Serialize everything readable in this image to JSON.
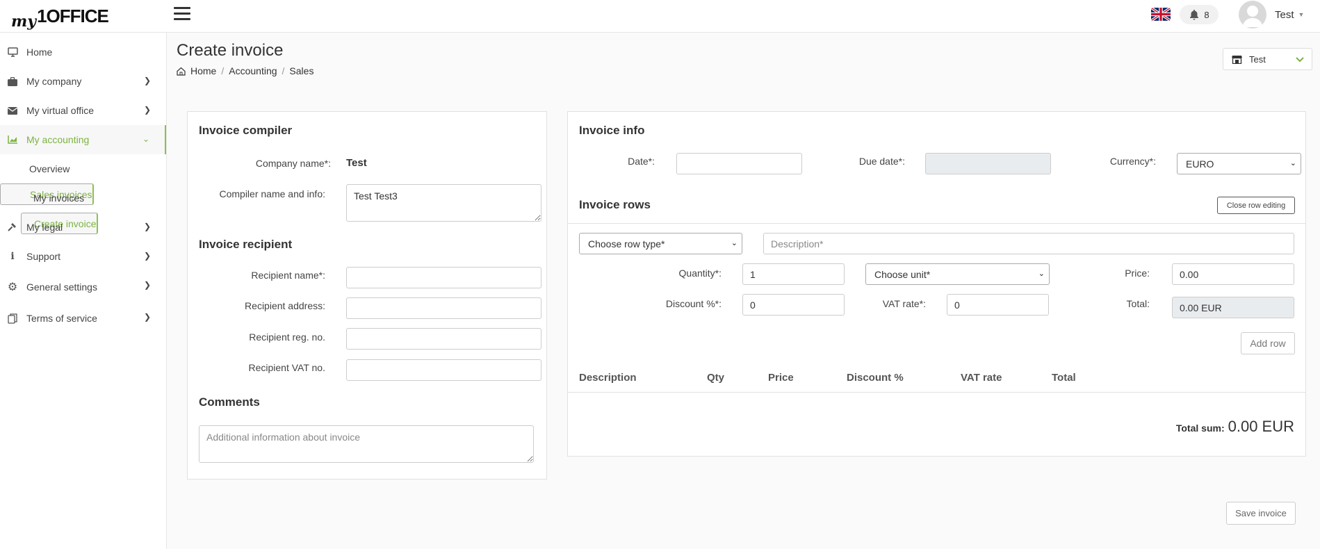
{
  "header": {
    "logo_prefix": "my",
    "logo_main": "1OFFICE",
    "notifications_count": "8",
    "user_name": "Test",
    "language_flag": "uk-flag-icon"
  },
  "sidebar": {
    "items": [
      {
        "label": "Home",
        "icon": "monitor-icon"
      },
      {
        "label": "My company",
        "icon": "briefcase-icon"
      },
      {
        "label": "My virtual office",
        "icon": "envelope-icon"
      },
      {
        "label": "My accounting",
        "icon": "chart-icon"
      },
      {
        "label": "My legal",
        "icon": "gavel-icon"
      },
      {
        "label": "Support",
        "icon": "info-icon"
      },
      {
        "label": "General settings",
        "icon": "gear-icon"
      },
      {
        "label": "Terms of service",
        "icon": "documents-icon"
      }
    ],
    "accounting_sub": {
      "overview": "Overview",
      "sales_invoices": "Sales invoices",
      "my_invoices": "My invoices",
      "create_invoice": "Create invoice"
    },
    "accent_color": "#7cb342"
  },
  "page": {
    "title": "Create invoice",
    "breadcrumb": [
      "Home",
      "Accounting",
      "Sales"
    ],
    "company_selector": "Test"
  },
  "compiler": {
    "heading": "Invoice compiler",
    "company_label": "Company name*:",
    "company_value": "Test",
    "compiler_label": "Compiler name and info:",
    "compiler_value": "Test Test3"
  },
  "recipient": {
    "heading": "Invoice recipient",
    "name_label": "Recipient name*:",
    "address_label": "Recipient address:",
    "reg_label": "Recipient reg. no.",
    "vat_label": "Recipient VAT no."
  },
  "comments": {
    "heading": "Comments",
    "placeholder": "Additional information about invoice"
  },
  "invoice_info": {
    "heading": "Invoice info",
    "date_label": "Date*:",
    "due_label": "Due date*:",
    "currency_label": "Currency*:",
    "currency_value": "EURO"
  },
  "invoice_rows": {
    "heading": "Invoice rows",
    "close_button": "Close row editing",
    "row_type_placeholder": "Choose row type*",
    "description_placeholder": "Description*",
    "quantity_label": "Quantity*:",
    "quantity_value": "1",
    "unit_placeholder": "Choose unit*",
    "price_label": "Price:",
    "price_value": "0.00",
    "discount_label": "Discount %*:",
    "discount_value": "0",
    "vat_label": "VAT rate*:",
    "vat_value": "0",
    "total_label": "Total:",
    "total_value": "0.00 EUR",
    "add_row": "Add row",
    "columns": [
      "Description",
      "Qty",
      "Price",
      "Discount %",
      "VAT rate",
      "Total"
    ],
    "total_sum_label": "Total sum:",
    "total_sum_value": "0.00 EUR"
  },
  "save_button": "Save invoice"
}
